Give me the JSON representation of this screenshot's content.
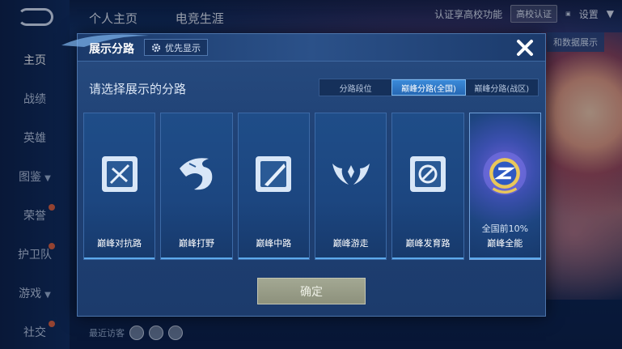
{
  "background": {
    "nav": [
      {
        "label": "主页",
        "active": true
      },
      {
        "label": "战绩"
      },
      {
        "label": "英雄"
      },
      {
        "label": "图鉴",
        "arrow": true
      },
      {
        "label": "荣誉",
        "dot": true
      },
      {
        "label": "护卫队",
        "dot": true
      },
      {
        "label": "游戏",
        "arrow": true
      },
      {
        "label": "社交",
        "dot": true
      }
    ],
    "top_tabs": [
      "个人主页",
      "电竞生涯"
    ],
    "cert_text": "认证享高校功能",
    "cert_button": "高校认证",
    "settings_label": "设置",
    "right_button": "和数据展示",
    "recent_visitors": "最近访客"
  },
  "modal": {
    "title": "展示分路",
    "priority_label": "优先显示",
    "prompt": "请选择展示的分路",
    "segments": [
      {
        "label": "分路段位",
        "active": false
      },
      {
        "label": "巅峰分路(全国)",
        "active": true
      },
      {
        "label": "巅峰分路(战区)",
        "active": false
      }
    ],
    "cards": [
      {
        "label": "巅峰对抗路",
        "icon": "sword-icon"
      },
      {
        "label": "巅峰打野",
        "icon": "dragon-icon"
      },
      {
        "label": "巅峰中路",
        "icon": "staff-icon"
      },
      {
        "label": "巅峰游走",
        "icon": "wings-icon"
      },
      {
        "label": "巅峰发育路",
        "icon": "target-icon"
      },
      {
        "label": "巅峰全能",
        "icon": "allround-badge-icon",
        "rank": "全国前10%",
        "selected": true
      }
    ],
    "confirm_label": "确定"
  },
  "colors": {
    "accent": "#3b8ad9",
    "selected_glow": "#6a5fd6",
    "confirm_bg": "#8d917c"
  }
}
